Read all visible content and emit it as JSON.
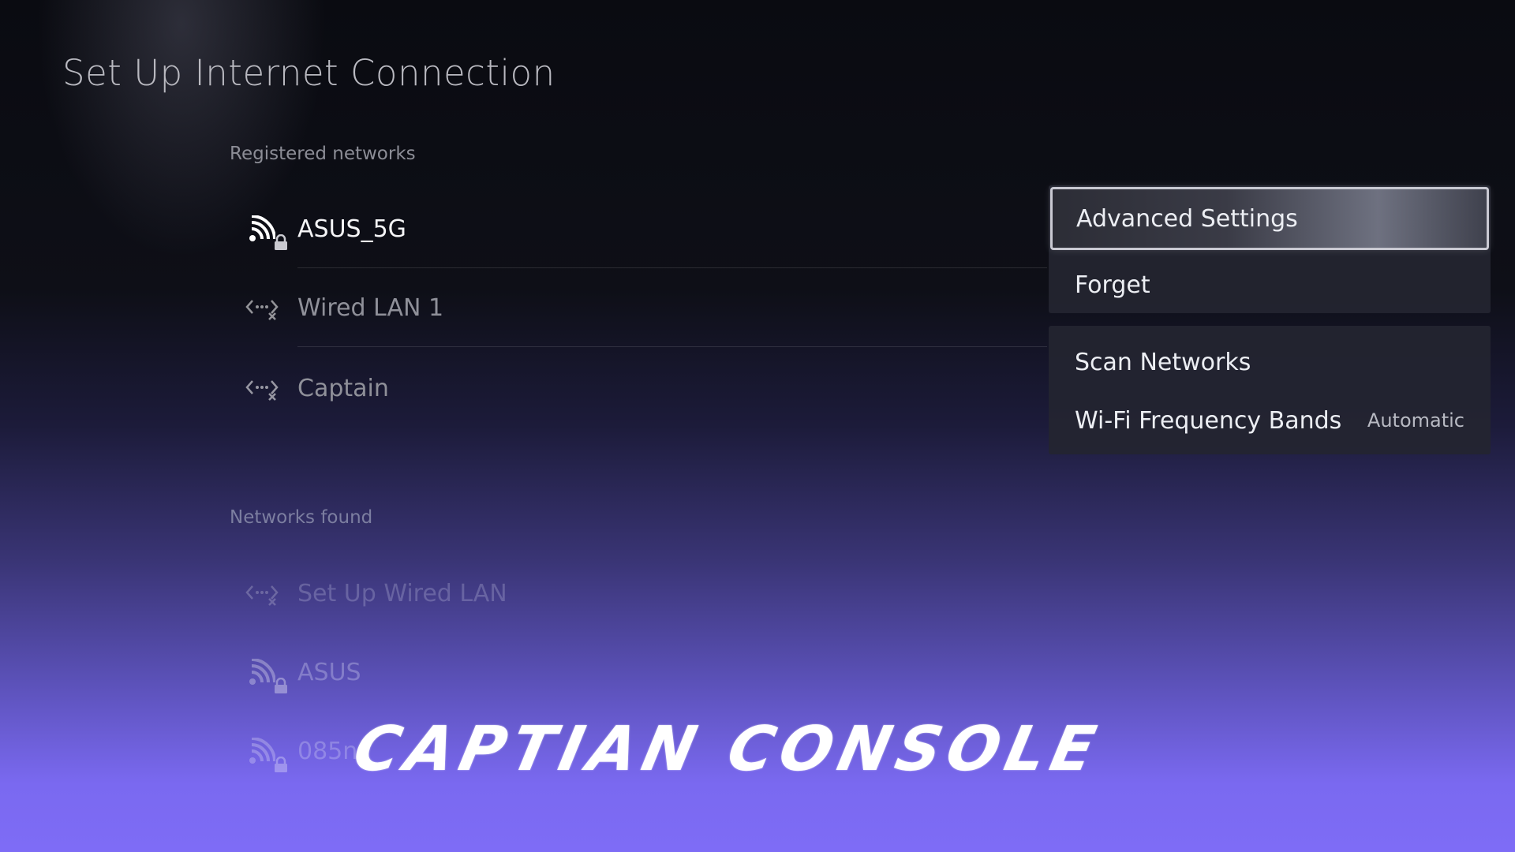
{
  "page_title": "Set Up Internet Connection",
  "registered": {
    "title": "Registered networks",
    "items": [
      {
        "label": "ASUS_5G",
        "icon": "wifi-icon",
        "locked": true
      },
      {
        "label": "Wired LAN 1",
        "icon": "wired-lan-disconnected-icon"
      },
      {
        "label": "Captain",
        "icon": "wired-lan-disconnected-icon"
      }
    ]
  },
  "found": {
    "title": "Networks found",
    "items": [
      {
        "label": "Set Up Wired LAN",
        "icon": "wired-lan-disconnected-icon"
      },
      {
        "label": "ASUS",
        "icon": "wifi-icon",
        "locked": true
      },
      {
        "label": "085n",
        "icon": "wifi-icon",
        "locked": true
      }
    ]
  },
  "menu": {
    "advanced_settings": "Advanced Settings",
    "forget": "Forget",
    "scan_networks": "Scan Networks",
    "wifi_bands": "Wi-Fi Frequency Bands",
    "wifi_bands_value": "Automatic"
  },
  "watermark": "CAPTIAN CONSOLE",
  "colors": {
    "background_top": "#0a0b11",
    "background_bottom": "#7e6cf6",
    "menu_bg": "#24253a",
    "focus_border": "#c9c9d2"
  }
}
